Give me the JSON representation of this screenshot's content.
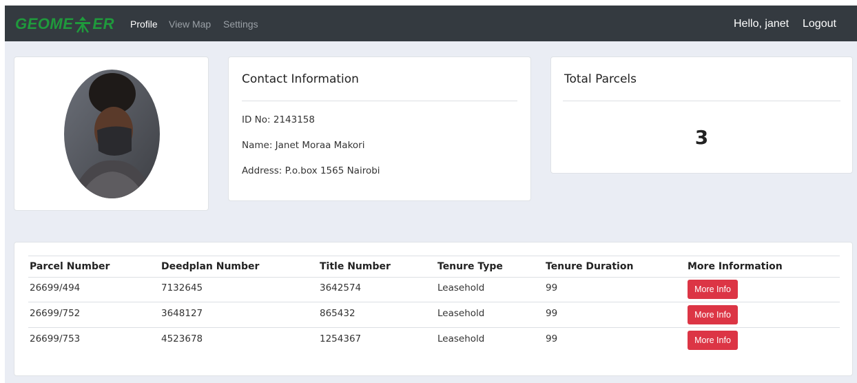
{
  "brand": {
    "logo_text_left": "GEOME",
    "logo_text_right": "ER"
  },
  "nav": {
    "links": [
      {
        "label": "Profile"
      },
      {
        "label": "View Map"
      },
      {
        "label": "Settings"
      }
    ],
    "greeting": "Hello, janet",
    "logout": "Logout"
  },
  "contact": {
    "title": "Contact Information",
    "id_line": "ID No: 2143158",
    "name_line": "Name: Janet Moraa Makori",
    "address_line": "Address: P.o.box 1565 Nairobi"
  },
  "parcels_summary": {
    "title": "Total Parcels",
    "count": "3"
  },
  "table": {
    "headers": [
      "Parcel Number",
      "Deedplan Number",
      "Title Number",
      "Tenure Type",
      "Tenure Duration",
      "More Information"
    ],
    "rows": [
      {
        "parcel": "26699/494",
        "deedplan": "7132645",
        "title": "3642574",
        "tenure_type": "Leasehold",
        "duration": "99",
        "button": "More Info"
      },
      {
        "parcel": "26699/752",
        "deedplan": "3648127",
        "title": "865432",
        "tenure_type": "Leasehold",
        "duration": "99",
        "button": "More Info"
      },
      {
        "parcel": "26699/753",
        "deedplan": "4523678",
        "title": "1254367",
        "tenure_type": "Leasehold",
        "duration": "99",
        "button": "More Info"
      }
    ]
  },
  "colors": {
    "navbar": "#343a40",
    "page_bg": "#eaedf4",
    "brand_green": "#1f9a3c",
    "button_red": "#dc3545"
  }
}
